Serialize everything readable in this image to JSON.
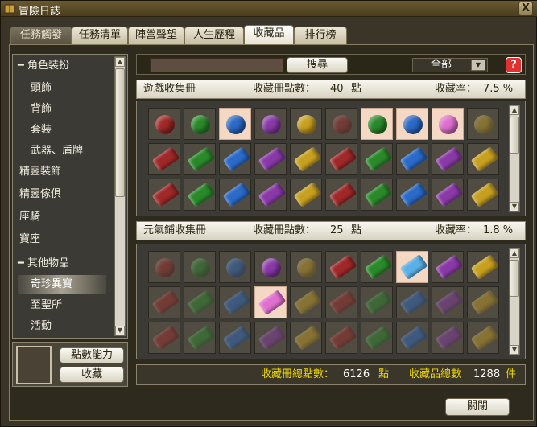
{
  "window": {
    "title": "冒險日誌",
    "close_symbol": "X"
  },
  "tabs": [
    {
      "label": "任務觸發"
    },
    {
      "label": "任務清單"
    },
    {
      "label": "陣營聲望"
    },
    {
      "label": "人生歷程"
    },
    {
      "label": "收藏品"
    },
    {
      "label": "排行榜"
    }
  ],
  "active_tab": "收藏品",
  "sidebar": {
    "items": [
      {
        "label": "━ 角色裝扮"
      },
      {
        "label": "頭飾"
      },
      {
        "label": "背飾"
      },
      {
        "label": "套裝"
      },
      {
        "label": "武器、盾牌"
      },
      {
        "label": "精靈裝飾"
      },
      {
        "label": "精靈傢俱"
      },
      {
        "label": "座騎"
      },
      {
        "label": "寶座"
      },
      {
        "label": "━ 其他物品"
      },
      {
        "label": "奇珍異寶"
      },
      {
        "label": "至聖所"
      },
      {
        "label": "活動"
      }
    ],
    "active_item": "奇珍異寶",
    "points_button": "點數能力",
    "collect_button": "收藏"
  },
  "search": {
    "button": "搜尋",
    "input_value": "",
    "filter_value": "全部",
    "help_symbol": "?"
  },
  "sections": [
    {
      "title": "遊戲收集冊",
      "points_label": "收藏冊點數：",
      "points": "40",
      "points_unit": "點",
      "rate_label": "收藏率：",
      "rate": "7.5 %"
    },
    {
      "title": "元氣鋪收集冊",
      "points_label": "收藏冊點數：",
      "points": "25",
      "points_unit": "點",
      "rate_label": "收藏率：",
      "rate": "1.8 %"
    }
  ],
  "footer": {
    "total_points_label": "收藏冊總點數：",
    "total_points": "6126",
    "points_unit": "點",
    "total_count_label": "收藏品總數",
    "total_count": "1288",
    "count_unit": "件"
  },
  "close_button": "關閉",
  "colors": {
    "red": "#a02828",
    "green": "#2a8a2a",
    "blue": "#2a6ac8",
    "purple": "#8a3aa8",
    "gold": "#c8a020",
    "cyan": "#5ab0e8",
    "pink": "#e070d0"
  }
}
